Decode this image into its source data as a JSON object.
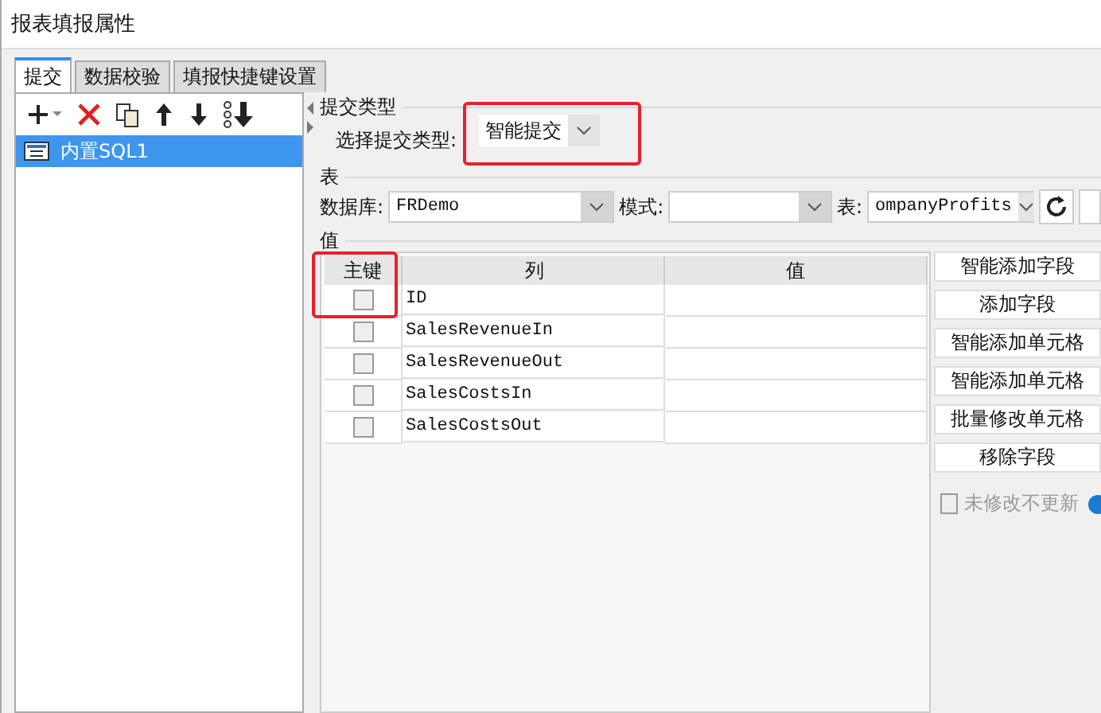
{
  "window": {
    "title": "报表填报属性"
  },
  "tabs": [
    {
      "label": "提交",
      "selected": true
    },
    {
      "label": "数据校验",
      "selected": false
    },
    {
      "label": "填报快捷键设置",
      "selected": false
    }
  ],
  "list_items": [
    {
      "label": "内置SQL1",
      "selected": true
    }
  ],
  "submit_type": {
    "section_label": "提交类型",
    "label": "选择提交类型:",
    "value": "智能提交"
  },
  "table_section": {
    "section_label": "表",
    "database_label": "数据库:",
    "database": "FRDemo",
    "schema_label": "模式:",
    "table_label": "表:",
    "table": "ompanyProfits"
  },
  "values_section": {
    "section_label": "值",
    "columns": [
      "主键",
      "列",
      "值"
    ],
    "rows": [
      {
        "checked": false,
        "column": "ID"
      },
      {
        "checked": false,
        "column": "SalesRevenueIn"
      },
      {
        "checked": false,
        "column": "SalesRevenueOut"
      },
      {
        "checked": false,
        "column": "SalesCostsIn"
      },
      {
        "checked": false,
        "column": "SalesCostsOut"
      }
    ]
  },
  "buttons": [
    "智能添加字段",
    "添加字段",
    "智能添加单元格",
    "智能添加单元格",
    "批量修改单元格",
    "移除字段"
  ],
  "option": {
    "label": "未修改不更新",
    "checked": false,
    "disabled": true
  }
}
